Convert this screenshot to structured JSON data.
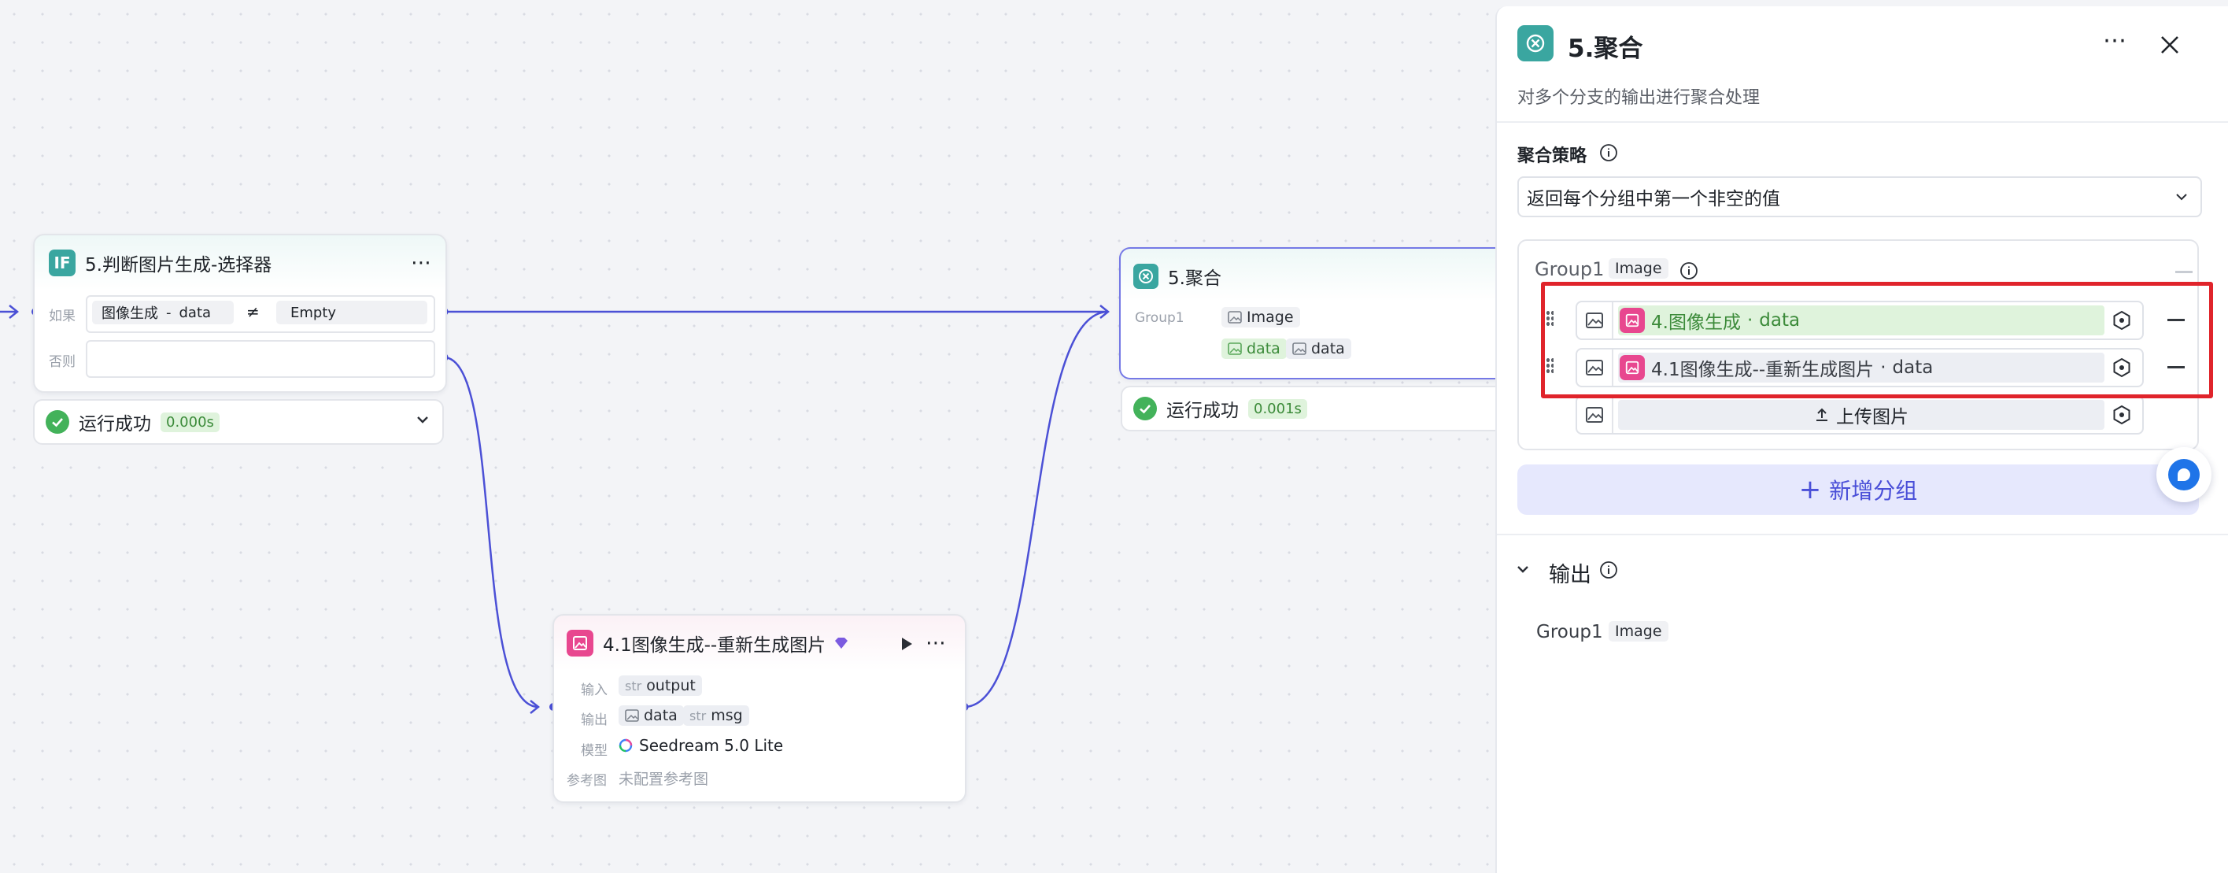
{
  "canvas": {
    "if_node": {
      "title": "5.判断图片生成-选择器",
      "icon": "IF",
      "if_label": "如果",
      "else_label": "否则",
      "cond_left_a": "图像生成",
      "cond_left_sep": "-",
      "cond_left_b": "data",
      "cond_op": "≠",
      "cond_right": "Empty",
      "status": "运行成功",
      "time": "0.000s"
    },
    "agg_node": {
      "title": "5.聚合",
      "group_label": "Group1",
      "type_tag": "Image",
      "var1": "data",
      "var2": "data",
      "status": "运行成功",
      "time": "0.001s"
    },
    "gen_node": {
      "title": "4.1图像生成--重新生成图片",
      "input_label": "输入",
      "input_var": "output",
      "output_label": "输出",
      "output_var1": "data",
      "output_var2": "msg",
      "str_prefix": "str",
      "model_label": "模型",
      "model_name": "Seedream 5.0 Lite",
      "ref_label": "参考图",
      "ref_value": "未配置参考图"
    }
  },
  "panel": {
    "title": "5.聚合",
    "description": "对多个分支的输出进行聚合处理",
    "strategy_label": "聚合策略",
    "strategy_value": "返回每个分组中第一个非空的值",
    "group_name": "Group1",
    "group_type": "Image",
    "items": [
      {
        "source": "4.图像生成",
        "sep": "·",
        "var": "data"
      },
      {
        "source": "4.1图像生成--重新生成图片",
        "sep": "·",
        "var": "data"
      }
    ],
    "upload_label": "上传图片",
    "add_group_label": "新增分组",
    "output_section": "输出",
    "output_group": "Group1",
    "output_type": "Image"
  },
  "colors": {
    "accent": "#4a4fd8",
    "edge": "#4b50d6",
    "highlight_box": "#e0242b",
    "success": "#43b25a",
    "pink_icon": "#e8478f",
    "teal_icon": "#3aa6a0"
  }
}
